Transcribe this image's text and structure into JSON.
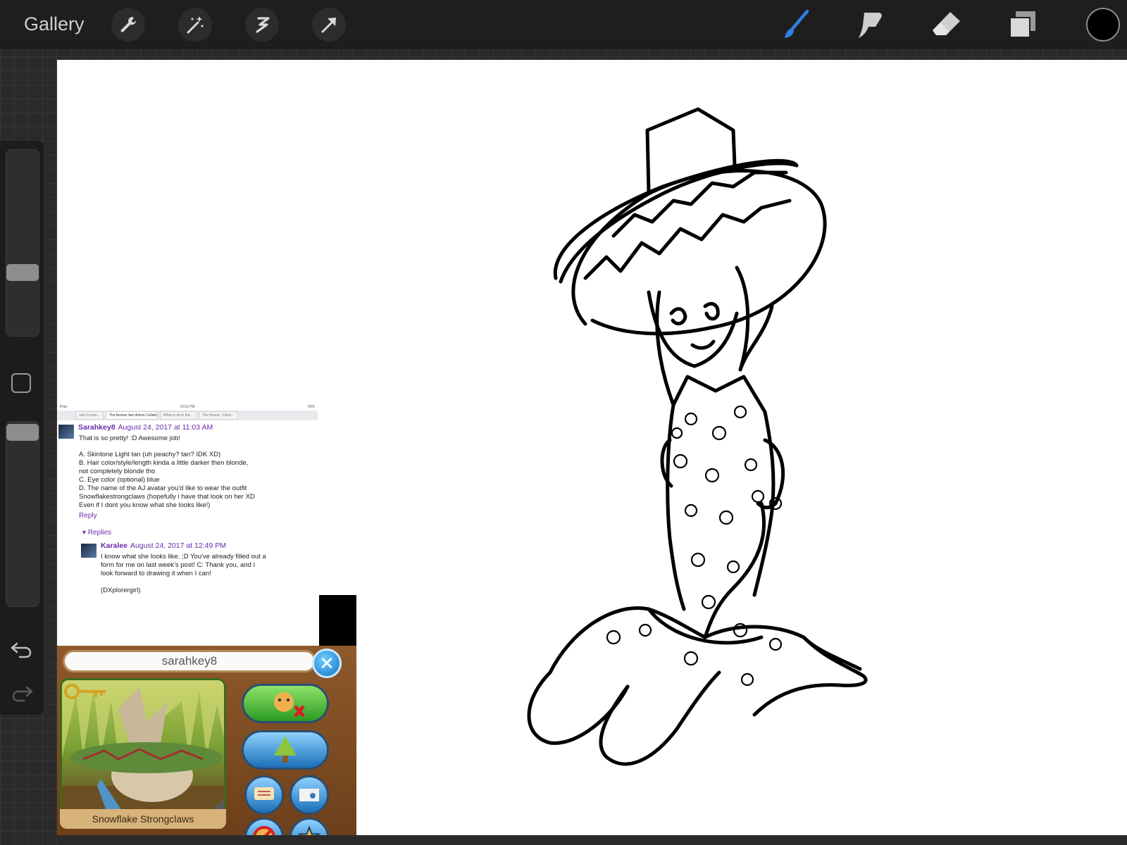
{
  "app": {
    "gallery_label": "Gallery",
    "toolbar": {
      "left_tools": [
        "wrench-icon",
        "magic-wand-icon",
        "selection-icon",
        "transform-arrow-icon"
      ],
      "right_tools": [
        "brush-icon",
        "smudge-icon",
        "eraser-icon",
        "layers-icon"
      ],
      "active_tool": "brush-icon",
      "accent_color": "#2f7fe6",
      "current_color": "#000000"
    },
    "sidebar": {
      "brush_size_level": 0.5,
      "opacity_level": 0.96,
      "icons": [
        "modify-square-icon",
        "undo-icon",
        "redo-icon"
      ]
    }
  },
  "reference_comment": {
    "tabs": [
      "Jam Comm...",
      "The Animal Jam Artists Collabo...",
      "What to do in the...",
      "The Hound - Chick..."
    ],
    "comment_author": "Sarahkey8",
    "comment_date": "August 24, 2017 at 11:03 AM",
    "comment_lines": [
      "That is so pretty! :D Awesome job!",
      "",
      "A. Skintone Light tan (uh peachy? tan? IDK XD)",
      "B. Hair color/style/length kinda a little darker then blonde,",
      "not completely blonde tho",
      "C. Eye color (optional) blue",
      "D. The name of the AJ avatar you'd like to wear the outfit",
      "Snowflakestrongclaws (hopefully i have that look on her XD",
      "Even if I dont you know what she looks like!)"
    ],
    "reply_label": "Reply",
    "replies_label": "Replies",
    "reply_author": "Karalee",
    "reply_date": "August 24, 2017 at 12:49 PM",
    "reply_lines": [
      "I know what she looks like. ;D You've already filled out a",
      "form for me on last week's post! C: Thank you, and I",
      "look forward to drawing it when I can!",
      "",
      "(DXplorergirl)"
    ]
  },
  "reference_game": {
    "username": "sarahkey8",
    "avatar_name": "Snowflake Strongclaws",
    "buttons": [
      "buddy-remove-icon",
      "den-icon",
      "chat-icon",
      "mail-icon",
      "block-icon",
      "report-badge-icon"
    ]
  }
}
